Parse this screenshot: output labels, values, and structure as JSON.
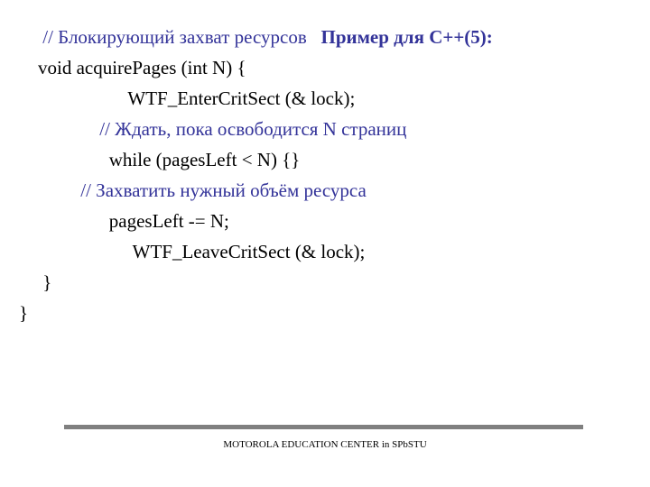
{
  "lines": {
    "l1a": "         // Блокирующий захват ресурсов   ",
    "l1b": "Пример для С++(5):",
    "l2": "        void acquirePages (int N) {",
    "l3": "                           WTF_EnterCritSect (& lock);",
    "l4": "                     // Ждать, пока освободится N страниц",
    "l5": "                       while (pagesLeft < N) {}",
    "l6": "                 // Захватить нужный объём ресурса",
    "l7": "                       pagesLeft -= N;",
    "l8": "                            WTF_LeaveCritSect (& lock);",
    "l9": "         }",
    "l10": "    }"
  },
  "footer": "MOTOROLA EDUCATION CENTER in SPbSTU"
}
